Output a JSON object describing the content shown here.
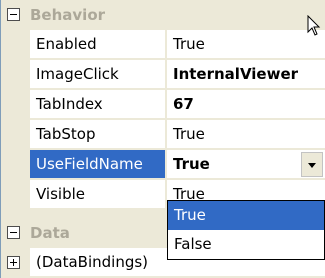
{
  "categories": {
    "behavior": "Behavior",
    "data": "Data"
  },
  "properties": [
    {
      "name": "Enabled",
      "value": "True",
      "bold": false
    },
    {
      "name": "ImageClick",
      "value": "InternalViewer",
      "bold": true
    },
    {
      "name": "TabIndex",
      "value": "67",
      "bold": true
    },
    {
      "name": "TabStop",
      "value": "True",
      "bold": false
    },
    {
      "name": "UseFieldName",
      "value": "True",
      "bold": true,
      "selected": true
    },
    {
      "name": "Visible",
      "value": "True",
      "bold": false
    }
  ],
  "dropdown_options": [
    "True",
    "False"
  ],
  "dropdown_highlighted": "True",
  "data_properties": [
    {
      "name": "(DataBindings)"
    }
  ],
  "colors": {
    "selection": "#316ac5",
    "category_text": "#aca899",
    "background": "#ece9d8"
  }
}
